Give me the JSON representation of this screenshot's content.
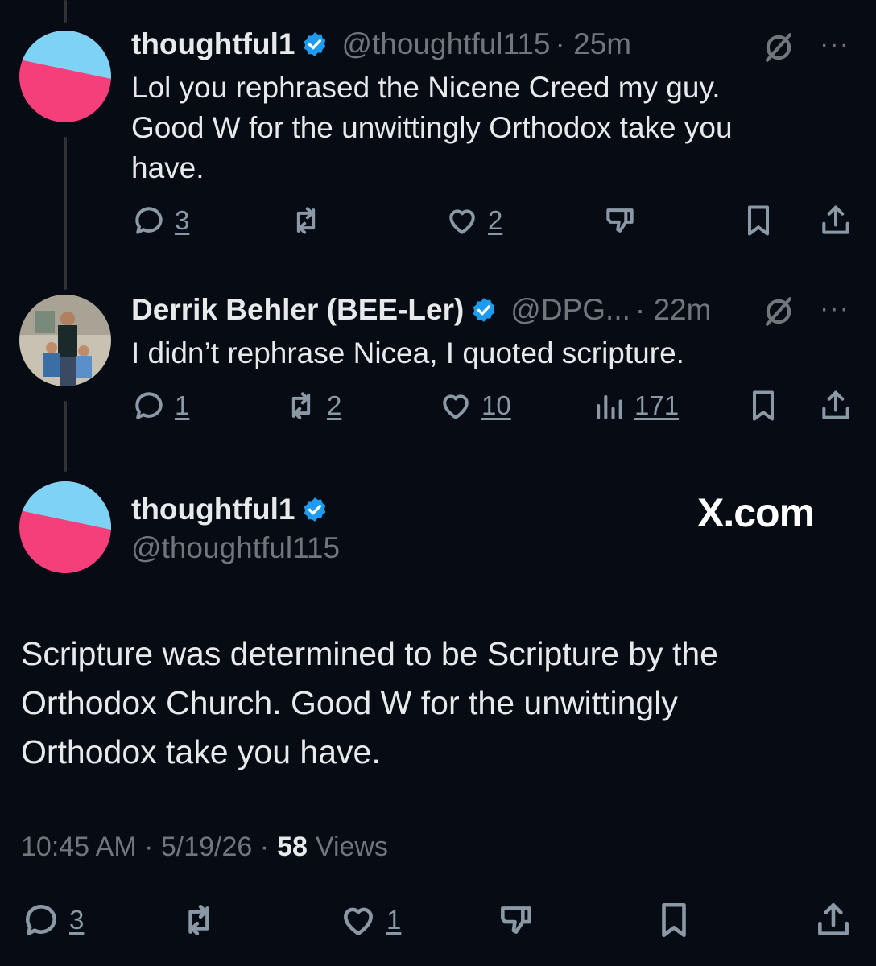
{
  "colors": {
    "background": "#060b14",
    "text": "#e7e9ea",
    "muted": "#71767b",
    "verified": "#1d9bf0",
    "avatar_top": "#7ed3f5",
    "avatar_bottom": "#f43f7a"
  },
  "replies": [
    {
      "name": "thoughtful1",
      "handle": "@thoughtful115",
      "time": "· 25m",
      "text_lines": [
        "Lol you rephrased the Nicene Creed my guy.",
        "Good W for the unwittingly Orthodox take you",
        "have."
      ],
      "reply_count": "3",
      "repost_count": "",
      "like_count": "2",
      "more": "···"
    },
    {
      "name": "Derrik Behler (BEE-Ler)",
      "handle": "@DPG...",
      "time": "· 22m",
      "text_lines": [
        "I didn’t rephrase Nicea, I quoted scripture."
      ],
      "reply_count": "1",
      "repost_count": "2",
      "like_count": "10",
      "view_count": "171",
      "more": "···"
    }
  ],
  "main": {
    "name": "thoughtful1",
    "handle": "@thoughtful115",
    "watermark": "X.com",
    "text_lines": [
      "Scripture was determined to be Scripture by the",
      "Orthodox Church. Good W for the unwittingly",
      "Orthodox take you have."
    ],
    "time": "10:45 AM · 5/19/26 ·",
    "views_count": "58",
    "views_label": "Views",
    "reply_count": "3",
    "like_count": "1"
  }
}
